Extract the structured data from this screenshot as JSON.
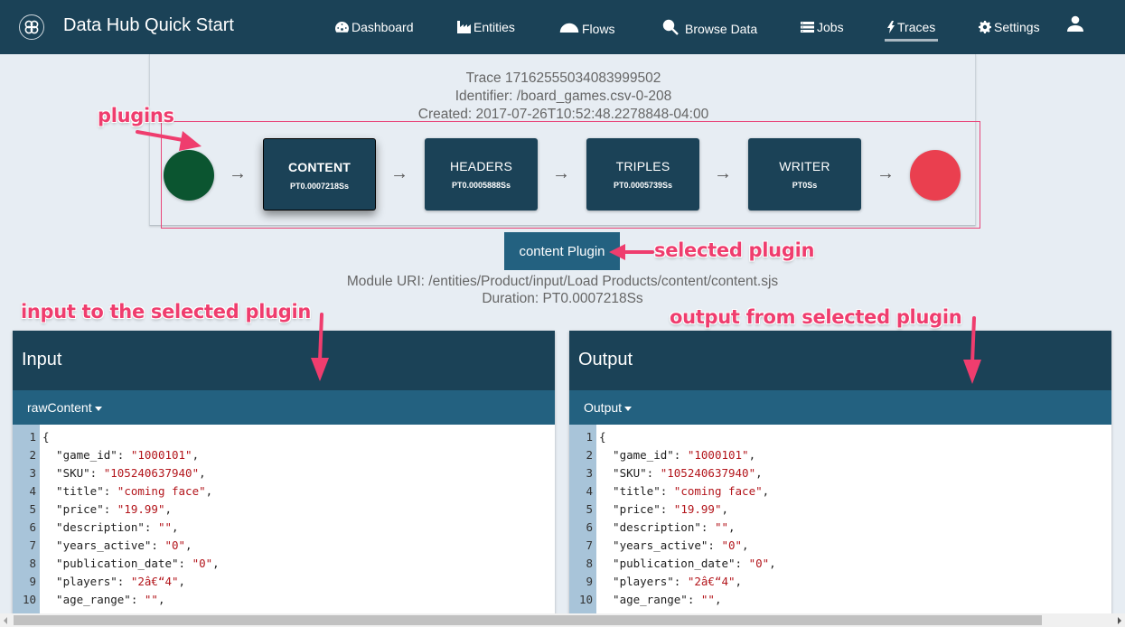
{
  "navbar": {
    "brand": "Data Hub Quick Start",
    "items": [
      {
        "label": "Dashboard",
        "icon": "dashboard-icon"
      },
      {
        "label": "Entities",
        "icon": "factory-icon"
      },
      {
        "label": "Flows",
        "icon": "flows-icon"
      },
      {
        "label": "Browse Data",
        "icon": "search-icon"
      },
      {
        "label": "Jobs",
        "icon": "list-icon"
      },
      {
        "label": "Traces",
        "icon": "bolt-icon",
        "active": true
      },
      {
        "label": "Settings",
        "icon": "gear-icon"
      }
    ],
    "user_icon": "user-icon"
  },
  "trace": {
    "title": "Trace 17162555034083999502",
    "identifier": "Identifier: /board_games.csv-0-208",
    "created": "Created: 2017-07-26T10:52:48.2278848-04:00"
  },
  "pipeline": {
    "start_color": "#0b5530",
    "end_color": "#ea3f4f",
    "plugins": [
      {
        "name": "CONTENT",
        "duration": "PT0.0007218Ss",
        "selected": true
      },
      {
        "name": "HEADERS",
        "duration": "PT0.0005888Ss"
      },
      {
        "name": "TRIPLES",
        "duration": "PT0.0005739Ss"
      },
      {
        "name": "WRITER",
        "duration": "PT0Ss"
      }
    ]
  },
  "selected_plugin": {
    "button_label": "content Plugin",
    "module_uri": "Module URI: /entities/Product/input/Load Products/content/content.sjs",
    "duration": "Duration: PT0.0007218Ss"
  },
  "annotations": {
    "plugins": "plugins",
    "selected_plugin": "selected plugin",
    "input": "input to the selected plugin",
    "output": "output from selected plugin",
    "color": "#ef3d6e"
  },
  "input_panel": {
    "title": "Input",
    "dropdown": "rawContent",
    "lines": [
      {
        "n": "1",
        "key": "{",
        "val": "",
        "end": ""
      },
      {
        "n": "2",
        "key": "  \"game_id\": ",
        "val": "\"1000101\"",
        "end": ","
      },
      {
        "n": "3",
        "key": "  \"SKU\": ",
        "val": "\"105240637940\"",
        "end": ","
      },
      {
        "n": "4",
        "key": "  \"title\": ",
        "val": "\"coming face\"",
        "end": ","
      },
      {
        "n": "5",
        "key": "  \"price\": ",
        "val": "\"19.99\"",
        "end": ","
      },
      {
        "n": "6",
        "key": "  \"description\": ",
        "val": "\"\"",
        "end": ","
      },
      {
        "n": "7",
        "key": "  \"years_active\": ",
        "val": "\"0\"",
        "end": ","
      },
      {
        "n": "8",
        "key": "  \"publication_date\": ",
        "val": "\"0\"",
        "end": ","
      },
      {
        "n": "9",
        "key": "  \"players\": ",
        "val": "\"2â€“4\"",
        "end": ","
      },
      {
        "n": "10",
        "key": "  \"age_range\": ",
        "val": "\"\"",
        "end": ","
      }
    ]
  },
  "output_panel": {
    "title": "Output",
    "dropdown": "Output",
    "lines": [
      {
        "n": "1",
        "key": "{",
        "val": "",
        "end": ""
      },
      {
        "n": "2",
        "key": "  \"game_id\": ",
        "val": "\"1000101\"",
        "end": ","
      },
      {
        "n": "3",
        "key": "  \"SKU\": ",
        "val": "\"105240637940\"",
        "end": ","
      },
      {
        "n": "4",
        "key": "  \"title\": ",
        "val": "\"coming face\"",
        "end": ","
      },
      {
        "n": "5",
        "key": "  \"price\": ",
        "val": "\"19.99\"",
        "end": ","
      },
      {
        "n": "6",
        "key": "  \"description\": ",
        "val": "\"\"",
        "end": ","
      },
      {
        "n": "7",
        "key": "  \"years_active\": ",
        "val": "\"0\"",
        "end": ","
      },
      {
        "n": "8",
        "key": "  \"publication_date\": ",
        "val": "\"0\"",
        "end": ","
      },
      {
        "n": "9",
        "key": "  \"players\": ",
        "val": "\"2â€“4\"",
        "end": ","
      },
      {
        "n": "10",
        "key": "  \"age_range\": ",
        "val": "\"\"",
        "end": ","
      }
    ]
  }
}
